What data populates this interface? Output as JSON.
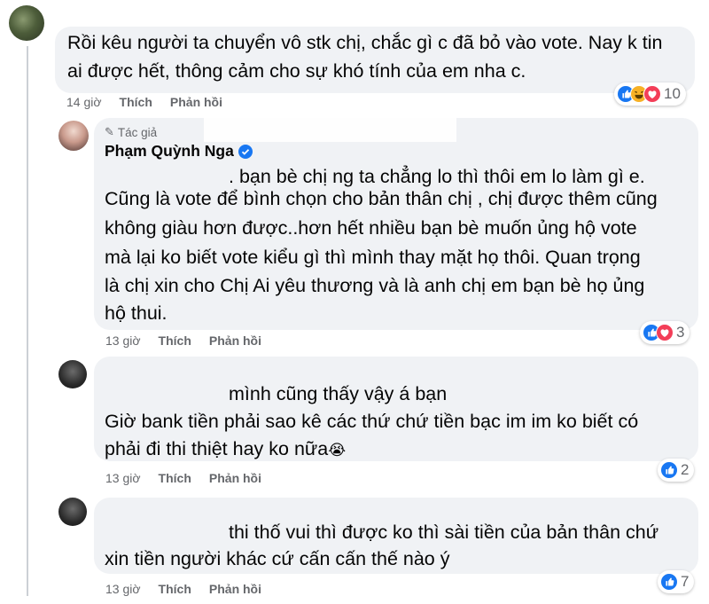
{
  "comments": [
    {
      "lines": [
        "Rồi kêu người ta chuyển vô stk chị, chắc gì c đã bỏ vào vote. Nay k tin",
        "ai được hết, thông cảm cho sự khó tính của em nha c."
      ],
      "time": "14 giờ",
      "like_label": "Thích",
      "reply_label": "Phản hồi",
      "reaction_count": "10",
      "reactions": [
        "like-icon",
        "haha-icon",
        "love-icon"
      ]
    },
    {
      "author_badge": "Tác giả",
      "author": "Phạm Quỳnh Nga",
      "verified": true,
      "lines": [
        ". bạn bè chị ng ta chẳng lo thì thôi em lo làm gì e.",
        "Cũng là vote để bình chọn cho bản thân chị , chị được thêm cũng",
        "không giàu hơn được..hơn hết nhiều bạn bè muốn ủng hộ vote",
        "mà lại ko biết vote kiểu gì thì mình thay mặt họ thôi. Quan trọng",
        "là chị xin cho Chị Ai yêu thương và là anh chị em bạn bè họ ủng",
        "hộ thui."
      ],
      "time": "13 giờ",
      "like_label": "Thích",
      "reply_label": "Phản hồi",
      "reaction_count": "3",
      "reactions": [
        "like-icon",
        "love-icon"
      ]
    },
    {
      "lines": [
        "mình cũng thấy vậy á bạn",
        "Giờ bank tiền phải sao kê các thứ chứ tiền bạc im im ko biết có",
        "phải đi thi thiệt hay ko nữa"
      ],
      "emoji": "😭",
      "time": "13 giờ",
      "like_label": "Thích",
      "reply_label": "Phản hồi",
      "reaction_count": "2",
      "reactions": [
        "like-icon"
      ]
    },
    {
      "lines": [
        "thi thố vui thì được ko thì sài tiền của bản thân chứ",
        "xin tiền người khác cứ cấn cấn thế nào ý"
      ],
      "time": "13 giờ",
      "like_label": "Thích",
      "reply_label": "Phản hồi",
      "reaction_count": "7",
      "reactions": [
        "like-icon"
      ]
    }
  ],
  "colors": {
    "bubble": "#f0f2f5",
    "meta": "#65676b",
    "like": "#1877f2",
    "love": "#f33e58",
    "haha": "#f7b125"
  }
}
